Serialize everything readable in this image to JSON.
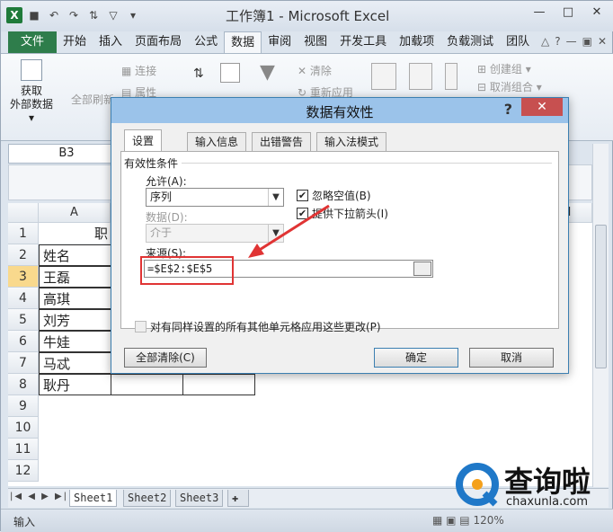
{
  "window": {
    "title": "工作簿1 - Microsoft Excel"
  },
  "ribbon_tabs": [
    "文件",
    "开始",
    "插入",
    "页面布局",
    "公式",
    "数据",
    "审阅",
    "视图",
    "开发工具",
    "加载项",
    "负载测试",
    "团队"
  ],
  "ribbon": {
    "get_external_line1": "获取",
    "get_external_line2": "外部数据",
    "refresh_all": "全部刷新",
    "connections": "连接",
    "properties": "属性",
    "clear": "清除",
    "reapply": "重新应用",
    "group": "创建组",
    "ungroup": "取消组合"
  },
  "name_box": "B3",
  "grid": {
    "columns": [
      "A",
      "H"
    ],
    "rows": [
      "1",
      "2",
      "3",
      "4",
      "5",
      "6",
      "7",
      "8",
      "9",
      "10",
      "11",
      "12"
    ],
    "b1_partial": "职",
    "names": [
      "姓名",
      "王磊",
      "高琪",
      "刘芳",
      "牛娃",
      "马忒",
      "耿丹"
    ]
  },
  "sheets": [
    "Sheet1",
    "Sheet2",
    "Sheet3"
  ],
  "status": {
    "mode": "输入",
    "zoom": "120%"
  },
  "dialog": {
    "title": "数据有效性",
    "help": "?",
    "tabs": [
      "设置",
      "输入信息",
      "出错警告",
      "输入法模式"
    ],
    "group_label": "有效性条件",
    "allow_label": "允许(A):",
    "allow_value": "序列",
    "data_label": "数据(D):",
    "data_value": "介于",
    "ignore_blank": "忽略空值(B)",
    "dropdown": "提供下拉箭头(I)",
    "source_label": "来源(S):",
    "source_value": "=$E$2:$E$5",
    "apply_all": "对有同样设置的所有其他单元格应用这些更改(P)",
    "clear_all": "全部清除(C)",
    "ok": "确定",
    "cancel": "取消"
  },
  "watermark": {
    "name": "查询啦",
    "site": "chaxunla.com"
  },
  "colors": {
    "file_tab": "#2e7d4b",
    "dialog_title": "#9bc3ea",
    "close": "#c75050",
    "highlight": "#e03434",
    "selected_row": "#f9d98d"
  }
}
